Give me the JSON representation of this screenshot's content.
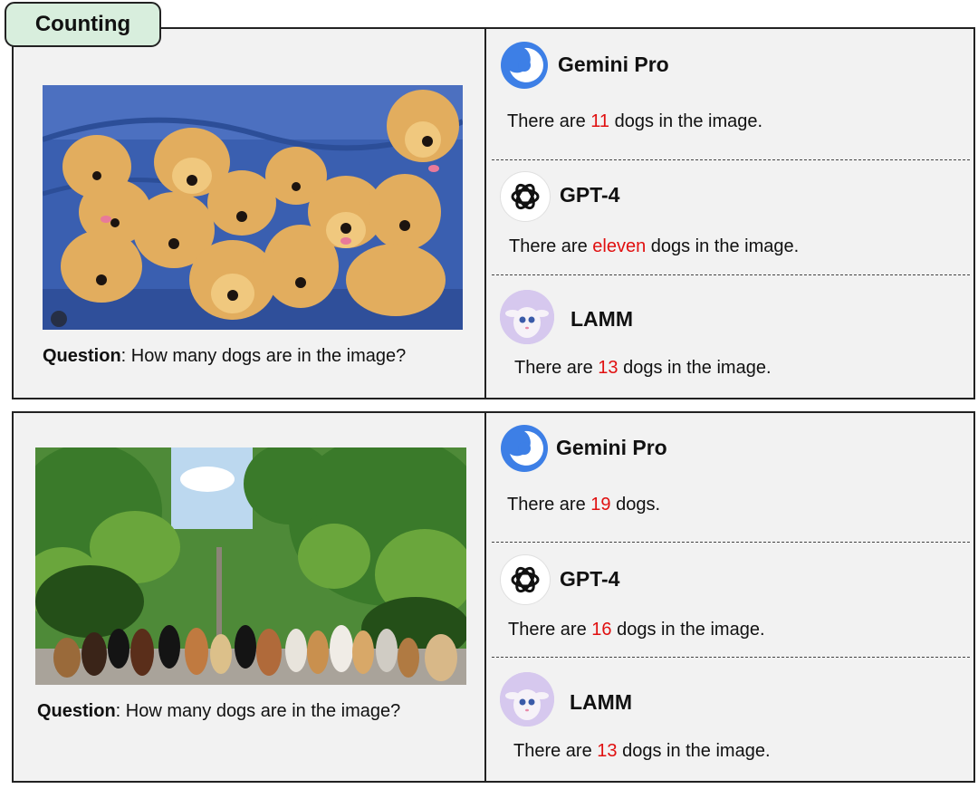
{
  "category_tag": "Counting",
  "panels": [
    {
      "question_label": "Question",
      "question_text": ": How many dogs are in the image?",
      "answers": [
        {
          "model": "Gemini Pro",
          "logo": "gemini-logo",
          "prefix": "There are ",
          "count": "11",
          "suffix": " dogs in the image."
        },
        {
          "model": "GPT-4",
          "logo": "openai-logo",
          "prefix": "There are ",
          "count": "eleven",
          "suffix": " dogs in the image."
        },
        {
          "model": "LAMM",
          "logo": "lamm-avatar",
          "prefix": "There are ",
          "count": "13",
          "suffix": " dogs in the image."
        }
      ]
    },
    {
      "question_label": "Question",
      "question_text": ": How many dogs are in the image?",
      "answers": [
        {
          "model": "Gemini Pro",
          "logo": "gemini-logo",
          "prefix": "There are ",
          "count": "19",
          "suffix": " dogs."
        },
        {
          "model": "GPT-4",
          "logo": "openai-logo",
          "prefix": "There are ",
          "count": "16",
          "suffix": " dogs in the image."
        },
        {
          "model": "LAMM",
          "logo": "lamm-avatar",
          "prefix": "There are ",
          "count": "13",
          "suffix": " dogs in the image."
        }
      ]
    }
  ],
  "colors": {
    "answer_count": "#e01010",
    "tag_background": "#d8eedd",
    "panel_background": "#f2f2f2"
  }
}
